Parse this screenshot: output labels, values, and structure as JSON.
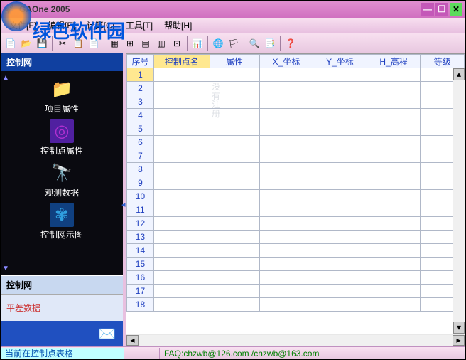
{
  "app": {
    "title": "GAOne 2005"
  },
  "watermark_site": "绿色软件园",
  "menu": {
    "file": "文件[F]",
    "edit": "编辑[E]",
    "calc": "计算[C]",
    "tools": "工具[T]",
    "help": "帮助[H]"
  },
  "sidebar": {
    "title": "控制网",
    "items": [
      {
        "label": "项目属性",
        "icon": "📁",
        "color": "#e0c020"
      },
      {
        "label": "控制点属性",
        "icon": "◎",
        "color": "#b030d0"
      },
      {
        "label": "观测数据",
        "icon": "🔭",
        "color": "#c04030"
      },
      {
        "label": "控制网示图",
        "icon": "✾",
        "color": "#30a0e0"
      }
    ],
    "section2": {
      "title": "控制网",
      "item": "平差数据"
    }
  },
  "grid": {
    "columns": [
      "序号",
      "控制点名",
      "属性",
      "X_坐标",
      "Y_坐标",
      "H_高程",
      "等级"
    ],
    "row_count": 18,
    "selected_row": 1,
    "selected_col": 1,
    "watermark": [
      "没",
      "有",
      "注",
      "册"
    ]
  },
  "status": {
    "left": "当前在控制点表格",
    "right": "FAQ:chzwb@126.com /chzwb@163.com"
  }
}
